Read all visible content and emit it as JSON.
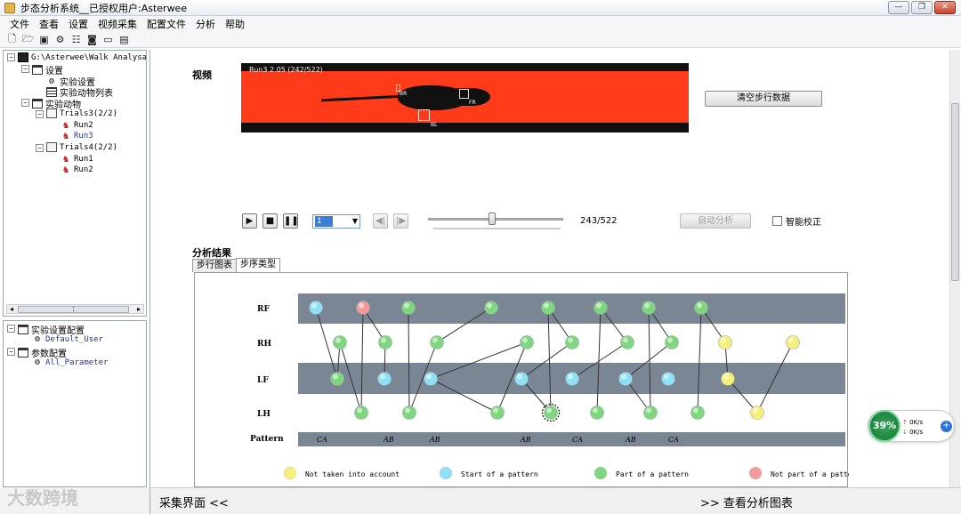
{
  "window": {
    "title": "步态分析系统__已授权用户:Asterwee"
  },
  "menu": [
    "文件",
    "查看",
    "设置",
    "视频采集",
    "配置文件",
    "分析",
    "帮助"
  ],
  "tree": {
    "root": "G:\\Asterwee\\Walk Analysator",
    "settings": "设置",
    "exp_settings": "实验设置",
    "animal_list": "实验动物列表",
    "animals": "实验动物",
    "trials3": "Trials3(2/2)",
    "t3run2": "Run2",
    "t3run3": "Run3",
    "trials4": "Trials4(2/2)",
    "t4run1": "Run1",
    "t4run2": "Run2"
  },
  "tree2": {
    "exp_config": "实验设置配置",
    "default_user": "Default_User",
    "param_config": "参数配置",
    "all_param": "All_Parameter"
  },
  "main": {
    "video_label": "视频",
    "video_overlay": "Run3  2.05  (242/522)",
    "clear_button": "清空步行数据",
    "frame_select": "1",
    "counter": "243/522",
    "auto_button": "自动分析",
    "smart_label": "智能校正",
    "results_label": "分析结果",
    "tabs": [
      "步行图表",
      "步序类型"
    ]
  },
  "video": {
    "paw_labels": {
      "BR": "BR",
      "FR": "FR",
      "BL": "BL"
    }
  },
  "chart_data": {
    "type": "scatter",
    "rows": [
      "RF",
      "RH",
      "LF",
      "LH"
    ],
    "pattern_label": "Pattern",
    "pattern_values": [
      "CA",
      "AB",
      "AB",
      "AB",
      "CA",
      "AB",
      "CA"
    ],
    "legend": [
      {
        "label": "Not taken into account",
        "color": "#f5f07a"
      },
      {
        "label": "Start of a pattern",
        "color": "#8fe0f5"
      },
      {
        "label": "Part of a pattern",
        "color": "#7ed67e"
      },
      {
        "label": "Not part of a patter",
        "color": "#f09a9a"
      }
    ]
  },
  "bottom": {
    "left": "采集界面  <<",
    "right": ">> 查看分析图表"
  },
  "watermark": "大数跨境",
  "net": {
    "percent": "39%",
    "up": "0K/s",
    "down": "0K/s"
  }
}
